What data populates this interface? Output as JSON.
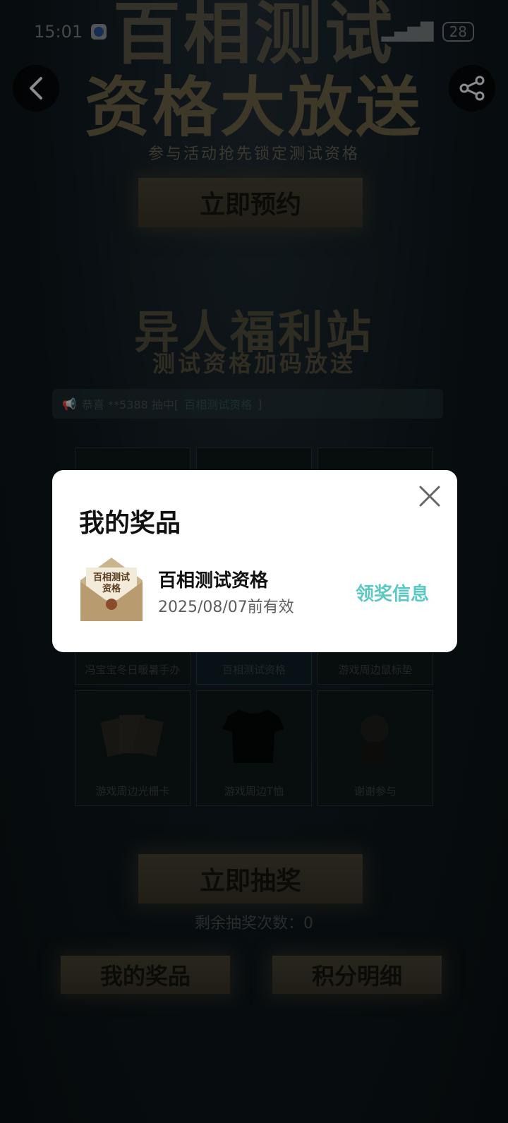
{
  "status_bar": {
    "time": "15:01",
    "battery": "28"
  },
  "hero": {
    "title_line1": "百相测试",
    "title_line2": "资格大放送",
    "subtitle": "参与活动抢先锁定测试资格",
    "reserve_button": "立即预约"
  },
  "section": {
    "title": "异人福利站",
    "subtitle": "测试资格加码放送"
  },
  "notice": {
    "prefix": "恭喜 **5388 抽中[",
    "prize": "百相测试资格",
    "suffix": "]"
  },
  "prizes": [
    {
      "label": ""
    },
    {
      "label": ""
    },
    {
      "label": ""
    },
    {
      "label": "冯宝宝冬日暖暑手办"
    },
    {
      "label": "百相测试资格"
    },
    {
      "label": "游戏周边鼠标垫"
    },
    {
      "label": "游戏周边光栅卡"
    },
    {
      "label": "游戏周边T恤"
    },
    {
      "label": "谢谢参与"
    }
  ],
  "draw_button": "立即抽奖",
  "remaining": "剩余抽奖次数：0",
  "bottom_buttons": {
    "my_prizes": "我的奖品",
    "points_detail": "积分明细"
  },
  "modal": {
    "title": "我的奖品",
    "prize_name": "百相测试资格",
    "prize_valid": "2025/08/07前有效",
    "claim_label": "领奖信息",
    "envelope_text": "百相测试资格"
  },
  "colors": {
    "accent_teal": "#5bc8c3"
  }
}
